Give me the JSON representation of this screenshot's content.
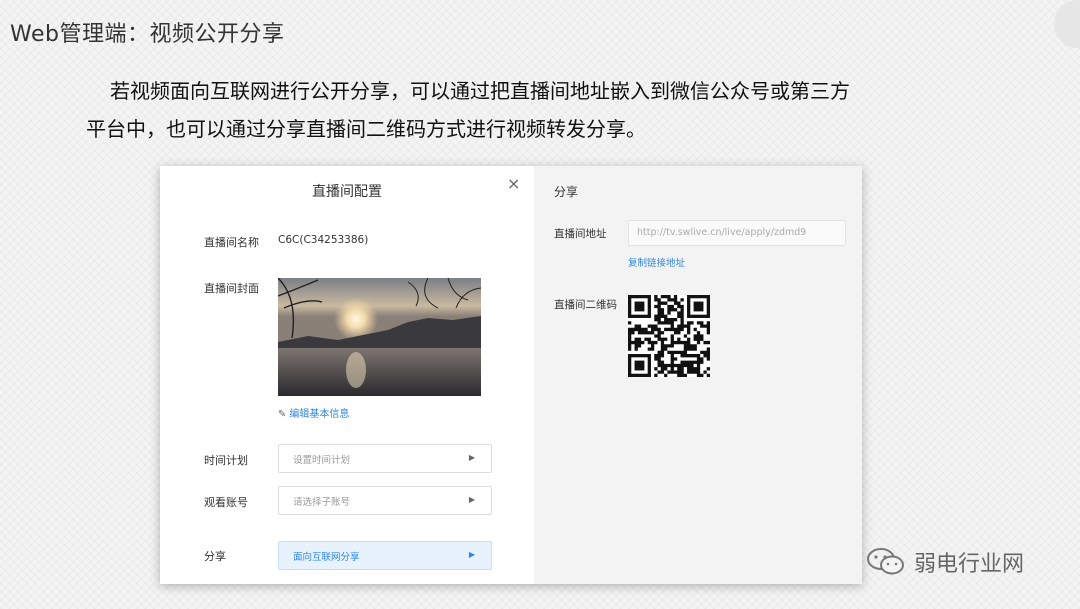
{
  "slide": {
    "title": "Web管理端：视频公开分享",
    "paragraph_line1": "若视频面向互联网进行公开分享，可以通过把直播间地址嵌入到微信公众号或第三方",
    "paragraph_line2": "平台中，也可以通过分享直播间二维码方式进行视频转发分享。"
  },
  "dialog": {
    "title": "直播间配置",
    "close_icon": "×",
    "name_label": "直播间名称",
    "name_value": "C6C(C34253386)",
    "cover_label": "直播间封面",
    "edit_link": "编辑基本信息",
    "schedule_label": "时间计划",
    "schedule_placeholder": "设置时间计划",
    "viewer_label": "观看账号",
    "viewer_placeholder": "请选择子账号",
    "share_label": "分享",
    "share_value": "面向互联网分享"
  },
  "share_panel": {
    "title": "分享",
    "address_label": "直播间地址",
    "address_value": "http://tv.swlive.cn/live/apply/zdmd9",
    "copy_link": "复制链接地址",
    "qr_label": "直播间二维码"
  },
  "watermark": {
    "text": "弱电行业网"
  },
  "icons": {
    "close": "close-icon",
    "edit": "pencil-icon",
    "caret": "caret-right-icon",
    "qr": "qr-code-icon",
    "wechat": "wechat-icon"
  },
  "colors": {
    "link": "#2f86e5",
    "share_bg": "#e8f2fd",
    "panel_bg": "#f3f3f3"
  }
}
